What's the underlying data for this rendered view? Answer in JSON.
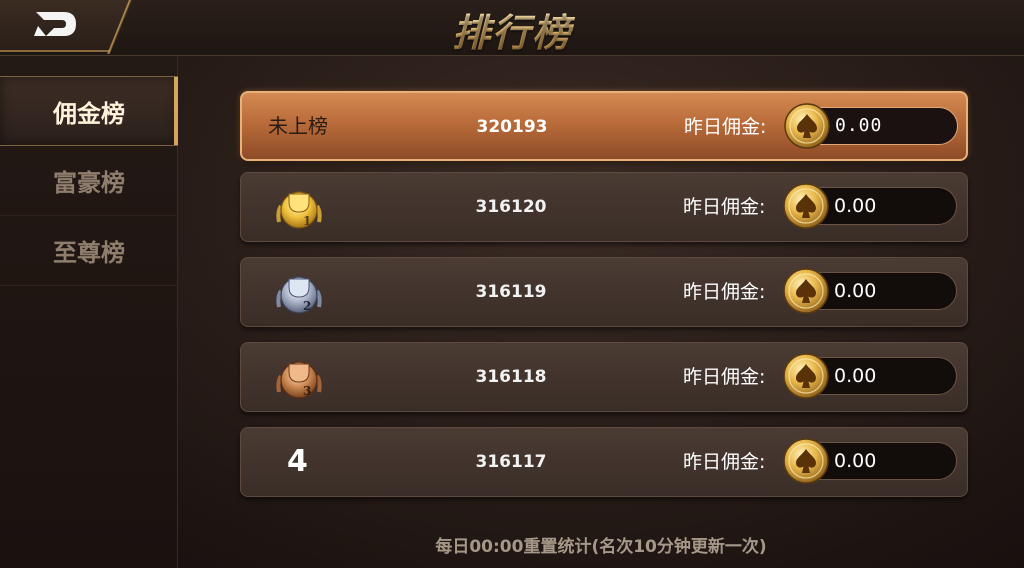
{
  "header": {
    "title": "排行榜"
  },
  "sidebar": {
    "items": [
      {
        "label": "佣金榜",
        "active": true
      },
      {
        "label": "富豪榜",
        "active": false
      },
      {
        "label": "至尊榜",
        "active": false
      }
    ]
  },
  "self_row": {
    "rank_text": "未上榜",
    "user_id": "320193",
    "label": "昨日佣金:",
    "value": "0.00"
  },
  "rows": [
    {
      "rank": "1",
      "rank_display": "gold-trophy-medal-icon",
      "user_id": "316120",
      "label": "昨日佣金:",
      "value": "0.00"
    },
    {
      "rank": "2",
      "rank_display": "silver-trophy-medal-icon",
      "user_id": "316119",
      "label": "昨日佣金:",
      "value": "0.00"
    },
    {
      "rank": "3",
      "rank_display": "bronze-trophy-medal-icon",
      "user_id": "316118",
      "label": "昨日佣金:",
      "value": "0.00"
    },
    {
      "rank": "4",
      "rank_display": "4",
      "user_id": "316117",
      "label": "昨日佣金:",
      "value": "0.00"
    }
  ],
  "footer": {
    "note": "每日00:00重置统计(名次10分钟更新一次)"
  },
  "colors": {
    "accent_gold": "#e8c17a",
    "self_row": "#b96c3a",
    "row_bg": "#3f312a"
  },
  "icons": {
    "back": "back-arrow-icon",
    "coin": "spade-coin-icon"
  }
}
